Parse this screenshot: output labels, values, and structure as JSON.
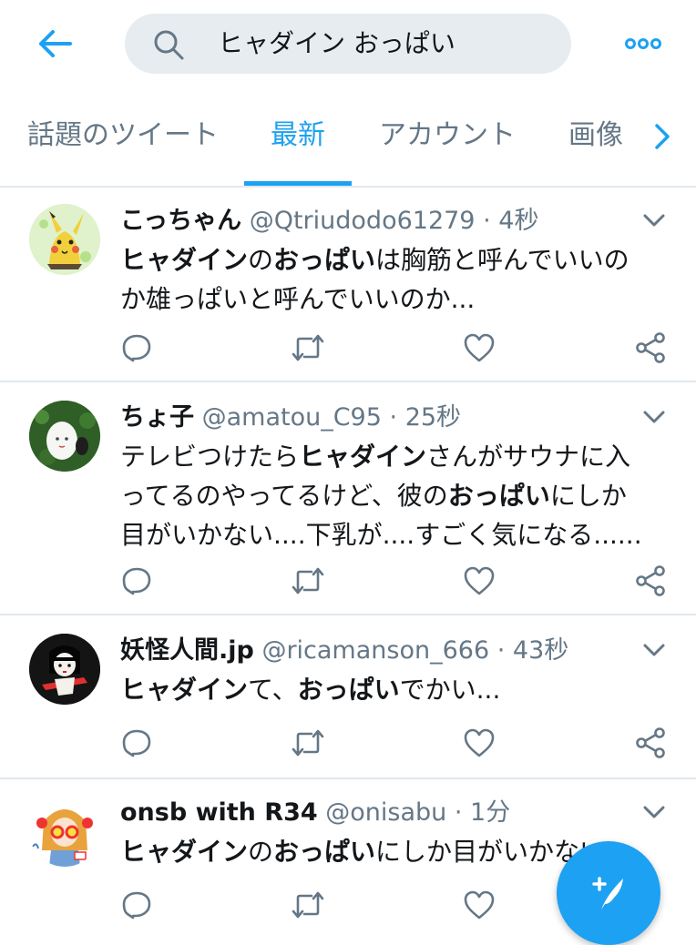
{
  "search": {
    "query": "ヒャダイン おっぱい"
  },
  "tabs": [
    {
      "label": "話題のツイート"
    },
    {
      "label": "最新"
    },
    {
      "label": "アカウント"
    },
    {
      "label": "画像"
    }
  ],
  "tweets": [
    {
      "name": "こっちゃん",
      "handle": "@Qtriudodo61279",
      "dot": "·",
      "time": "4秒",
      "lines": [
        [
          {
            "t": "ヒャダイン",
            "b": true
          },
          {
            "t": "の",
            "b": false
          },
          {
            "t": "おっぱい",
            "b": true
          },
          {
            "t": "は胸筋と呼んでいいの",
            "b": false
          }
        ],
        [
          {
            "t": "か雄っぱいと呼んでいいのか...",
            "b": false
          }
        ]
      ]
    },
    {
      "name": "ちょ子",
      "handle": "@amatou_C95",
      "dot": "·",
      "time": "25秒",
      "lines": [
        [
          {
            "t": "テレビつけたら",
            "b": false
          },
          {
            "t": "ヒャダイン",
            "b": true
          },
          {
            "t": "さんがサウナに入",
            "b": false
          }
        ],
        [
          {
            "t": "ってるのやってるけど、彼の",
            "b": false
          },
          {
            "t": "おっぱい",
            "b": true
          },
          {
            "t": "にしか",
            "b": false
          }
        ],
        [
          {
            "t": "目がいかない....下乳が....すごく気になる......",
            "b": false
          }
        ]
      ]
    },
    {
      "name": "妖怪人間.jp",
      "handle": "@ricamanson_666",
      "dot": "·",
      "time": "43秒",
      "lines": [
        [
          {
            "t": "ヒャダイン",
            "b": true
          },
          {
            "t": "て、",
            "b": false
          },
          {
            "t": "おっぱい",
            "b": true
          },
          {
            "t": "でかい...",
            "b": false
          }
        ]
      ]
    },
    {
      "name": "onsb with R34",
      "handle": "@onisabu",
      "dot": "·",
      "time": "1分",
      "lines": [
        [
          {
            "t": "ヒャダイン",
            "b": true
          },
          {
            "t": "の",
            "b": false
          },
          {
            "t": "おっぱい",
            "b": true
          },
          {
            "t": "にしか目がいかない",
            "b": false
          }
        ]
      ]
    }
  ],
  "icons": {
    "back": "arrow-left-icon",
    "search": "search-icon",
    "more": "more-dots-icon",
    "tab_next": "chevron-right-icon",
    "caret": "chevron-down-icon",
    "reply": "reply-icon",
    "retweet": "retweet-icon",
    "like": "heart-icon",
    "share": "share-icon",
    "compose": "compose-icon"
  },
  "colors": {
    "accent": "#1da1f2",
    "text": "#14171a",
    "secondary": "#657786",
    "divider": "#e1e8ed",
    "search_bg": "#e6ecf0"
  }
}
